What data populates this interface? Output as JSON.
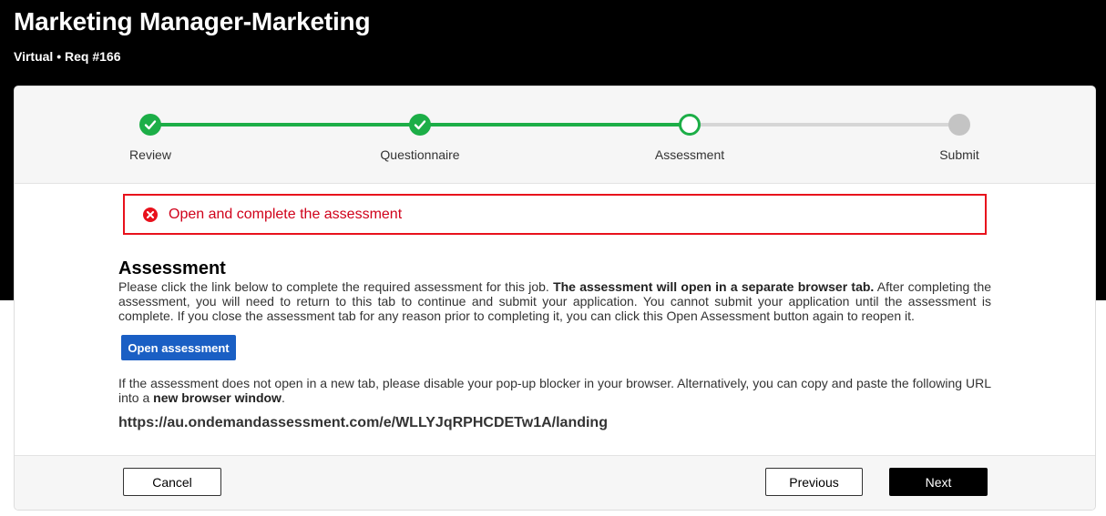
{
  "header": {
    "title": "Marketing Manager-Marketing",
    "subtitle": "Virtual • Req #166"
  },
  "stepper": {
    "steps": [
      {
        "label": "Review",
        "status": "complete"
      },
      {
        "label": "Questionnaire",
        "status": "complete"
      },
      {
        "label": "Assessment",
        "status": "current"
      },
      {
        "label": "Submit",
        "status": "pending"
      }
    ],
    "colors": {
      "complete": "#1cae47",
      "pending": "#c4c4c4"
    }
  },
  "alert": {
    "message": "Open and complete the assessment",
    "color": "#e8111c",
    "icon": "error-circle-icon"
  },
  "assessment": {
    "heading": "Assessment",
    "intro_1": "Please click the link below to complete the required assessment for this job.",
    "intro_bold": "The assessment will open in a separate browser tab.",
    "intro_2": "After completing the assessment, you will need to return to this tab to continue and submit your application. You cannot submit your application until the assessment is complete. If you close the assessment tab for any reason prior to completing it, you can click this Open Assessment button again to reopen it.",
    "open_button_label": "Open assessment",
    "popup_text": "If the assessment does not open in a new tab, please disable your pop-up blocker in your browser. Alternatively, you can copy and paste the following URL into a",
    "popup_bold": "new browser window",
    "popup_end": ".",
    "url": "https://au.ondemandassessment.com/e/WLLYJqRPHCDETw1A/landing"
  },
  "footer": {
    "cancel_label": "Cancel",
    "previous_label": "Previous",
    "next_label": "Next"
  }
}
